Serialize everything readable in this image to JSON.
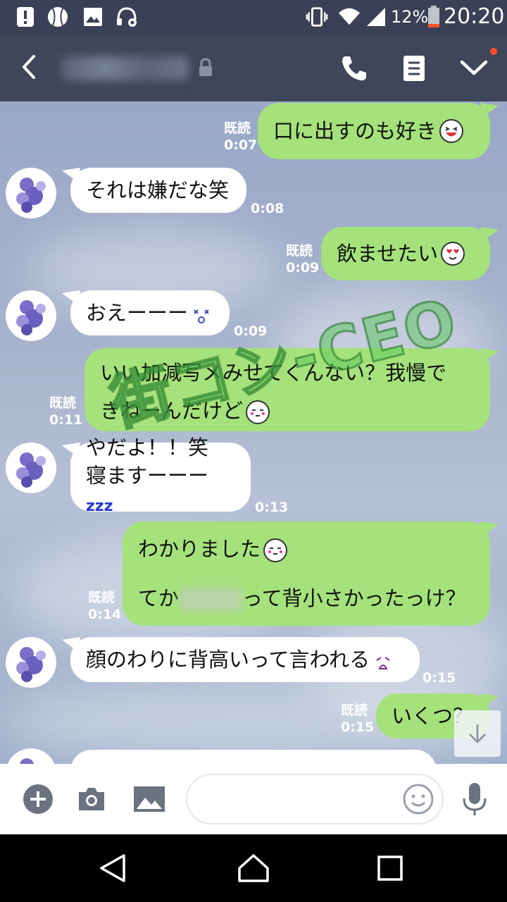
{
  "status_bar": {
    "battery_percent": "12%",
    "time": "20:20",
    "icons": [
      "alert-icon",
      "baseball-icon",
      "image-icon",
      "headset-icon",
      "vibrate-icon",
      "wifi-icon",
      "signal-icon",
      "battery-icon"
    ]
  },
  "header": {
    "icons": [
      "back-icon",
      "lock-icon",
      "phone-icon",
      "notes-icon",
      "chevron-down-icon"
    ],
    "accent_dot_color": "#ff4f2a"
  },
  "colors": {
    "outgoing_bubble": "#a5e27b",
    "incoming_bubble": "#ffffff",
    "header": "#3f4659"
  },
  "watermark": "街コン-CEO",
  "messages": [
    {
      "dir": "out",
      "text": "口に出すのも好き",
      "emoji": "laughing-emoji",
      "read": "既読",
      "time": "0:07"
    },
    {
      "dir": "in",
      "text": "それは嫌だな笑",
      "time": "0:08"
    },
    {
      "dir": "out",
      "text": "飲ませたい",
      "emoji": "heart-eyes-emoji",
      "read": "既読",
      "time": "0:09"
    },
    {
      "dir": "in",
      "text": "おえーーー",
      "emoji": "dizzy-emoji",
      "time": "0:09"
    },
    {
      "dir": "out",
      "line1": "いい加減写メみせてくんない？我慢で",
      "line2": "きねーんだけど",
      "emoji": "sleepy-face-emoji",
      "read": "既読",
      "time": "0:11"
    },
    {
      "dir": "in",
      "line1": "やだよ！！笑",
      "line2": "寝ますーーー",
      "zzz": "zzz",
      "time": "0:13"
    },
    {
      "dir": "out",
      "line1": "わかりました",
      "line2_pre": "てか",
      "line2_post": "って背小さかったっけ？",
      "emoji": "sleepy-face-emoji",
      "read": "既読",
      "time": "0:14"
    },
    {
      "dir": "in",
      "text": "顔のわりに背高いって言われる",
      "emoji": "crying-emoji",
      "time": "0:15"
    },
    {
      "dir": "out",
      "text": "いくつ？",
      "read": "既読",
      "time": "0:15"
    }
  ],
  "input": {
    "placeholder": "",
    "icons": [
      "plus-icon",
      "camera-icon",
      "gallery-icon",
      "smiley-icon",
      "mic-icon"
    ]
  },
  "navbar": {
    "icons": [
      "back-triangle-icon",
      "home-icon",
      "recents-icon"
    ]
  }
}
